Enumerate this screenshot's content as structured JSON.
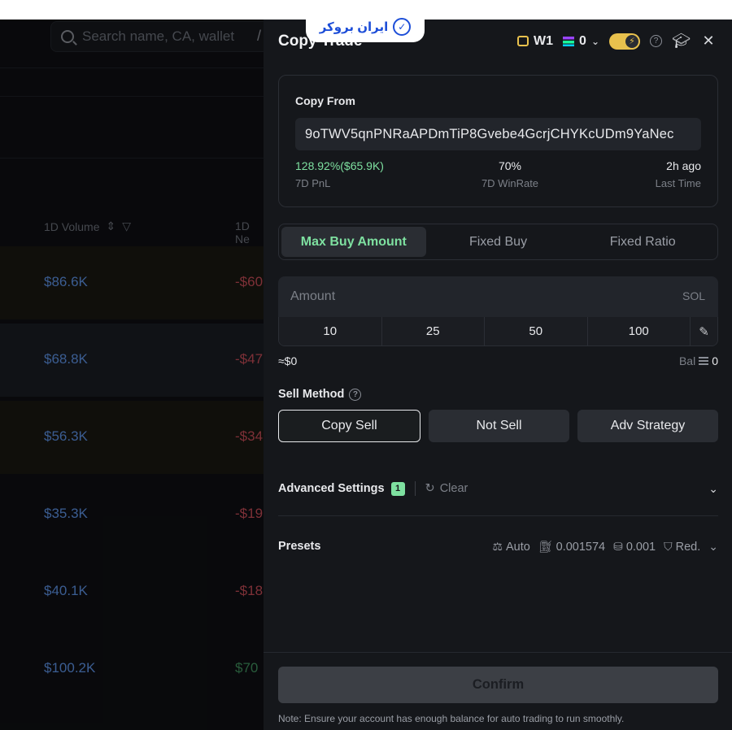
{
  "background": {
    "search_placeholder": "Search name, CA, wallet",
    "shortcut_hint": "/",
    "columns": [
      "1D Volume",
      "1D Ne"
    ],
    "rows": [
      {
        "volume": "$86.6K",
        "change": "-$60",
        "trend": "neg"
      },
      {
        "volume": "$68.8K",
        "change": "-$47",
        "trend": "neg"
      },
      {
        "volume": "$56.3K",
        "change": "-$34",
        "trend": "neg"
      },
      {
        "volume": "$35.3K",
        "change": "-$19",
        "trend": "neg"
      },
      {
        "volume": "$40.1K",
        "change": "-$18",
        "trend": "neg"
      },
      {
        "volume": "$100.2K",
        "change": "$70",
        "trend": "pos"
      }
    ]
  },
  "watermark": {
    "text": "ایران بروکر"
  },
  "panel": {
    "title": "Copy Trade",
    "wallet_label": "W1",
    "sol_balance": "0",
    "copy_from": {
      "label": "Copy From",
      "address": "9oTWV5qnPNRaAPDmTiP8Gvebe4GcrjCHYKcUDm9YaNec",
      "pnl_value": "128.92%($65.9K)",
      "pnl_label": "7D PnL",
      "winrate_value": "70%",
      "winrate_label": "7D WinRate",
      "last_value": "2h ago",
      "last_label": "Last Time"
    },
    "tabs": [
      "Max Buy Amount",
      "Fixed Buy",
      "Fixed Ratio"
    ],
    "active_tab": "Max Buy Amount",
    "amount": {
      "placeholder": "Amount",
      "unit": "SOL",
      "quick": [
        "10",
        "25",
        "50",
        "100"
      ],
      "approx": "≈$0",
      "bal_label": "Bal",
      "bal_value": "0"
    },
    "sell": {
      "title": "Sell Method",
      "options": [
        "Copy Sell",
        "Not Sell",
        "Adv Strategy"
      ],
      "selected": "Copy Sell"
    },
    "advanced": {
      "title": "Advanced Settings",
      "count": "1",
      "clear": "Clear"
    },
    "presets": {
      "title": "Presets",
      "slippage": "Auto",
      "gas": "0.001574",
      "priority": "0.001",
      "mev": "Red."
    },
    "confirm": "Confirm",
    "note": "Note: Ensure your account has enough balance for auto trading to run smoothly."
  },
  "colors": {
    "accent_green": "#7ee0a0",
    "toggle_yellow": "#e8c14d",
    "volume_blue": "#5b8fe0",
    "negative_red": "#c14a55"
  }
}
